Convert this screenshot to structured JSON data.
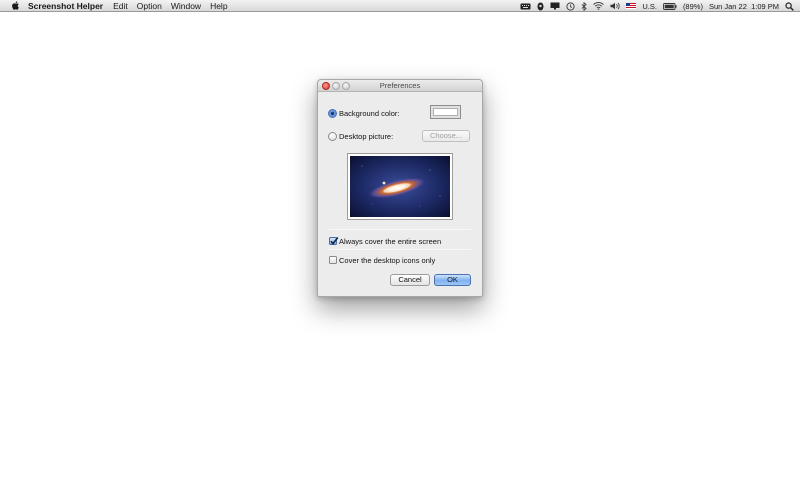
{
  "menubar": {
    "apple_icon": "apple-logo-icon",
    "app_name": "Screenshot Helper",
    "items": [
      "Edit",
      "Option",
      "Window",
      "Help"
    ],
    "status": {
      "input_source": "U.S.",
      "battery": "(89%)",
      "datetime": "Sun Jan 22  1:09 PM"
    }
  },
  "window": {
    "title": "Preferences",
    "background_color_label": "Background color:",
    "desktop_picture_label": "Desktop picture:",
    "choose_button": "Choose...",
    "selected_option": "Background color",
    "background_color_value": "#ffffff",
    "always_cover_label": "Always cover the entire screen",
    "always_cover_checked": true,
    "cover_icons_label": "Cover the desktop icons only",
    "cover_icons_checked": false,
    "cancel_button": "Cancel",
    "ok_button": "OK"
  },
  "colors": {
    "accent": "#3a6cc8",
    "close_button": "#d8332a"
  }
}
